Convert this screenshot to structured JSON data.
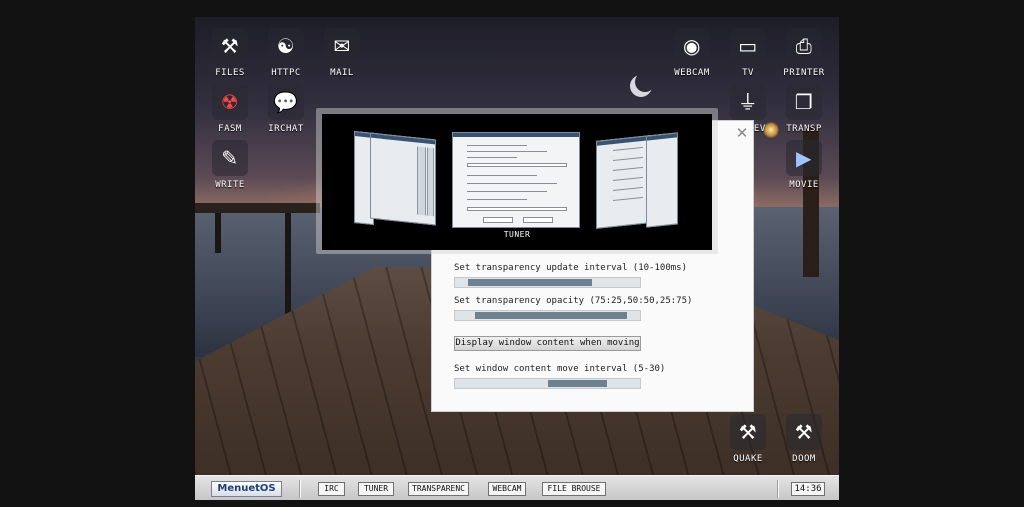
{
  "desktop": {
    "icons_left": [
      {
        "label": "FILES",
        "icon": "tools-icon",
        "glyph": "⚒"
      },
      {
        "label": "HTTPC",
        "icon": "yin-yang-icon",
        "glyph": "☯"
      },
      {
        "label": "MAIL",
        "icon": "mail-icon",
        "glyph": "✉"
      },
      {
        "label": "FASM",
        "icon": "radiation-icon",
        "glyph": "☢"
      },
      {
        "label": "IRCHAT",
        "icon": "chat-bubble-icon",
        "glyph": "💬"
      },
      {
        "label": "WRITE",
        "icon": "write-icon",
        "glyph": "✎"
      }
    ],
    "icons_right": [
      {
        "label": "WEBCAM",
        "icon": "webcam-icon",
        "glyph": "◉"
      },
      {
        "label": "TV",
        "icon": "tv-icon",
        "glyph": "▭"
      },
      {
        "label": "PRINTER",
        "icon": "printer-icon",
        "glyph": "⎙"
      },
      {
        "label": "USBDEV",
        "icon": "usb-icon",
        "glyph": "⏚"
      },
      {
        "label": "TRANSP",
        "icon": "transparency-icon",
        "glyph": "❐"
      },
      {
        "label": "MOVIE",
        "icon": "movie-icon",
        "glyph": "▶"
      },
      {
        "label": "QUAKE",
        "icon": "quake-tools-icon",
        "glyph": "⚒"
      },
      {
        "label": "DOOM",
        "icon": "doom-tools-icon",
        "glyph": "⚒"
      }
    ]
  },
  "switcher": {
    "caption": "TUNER"
  },
  "settings": {
    "close_glyph": "✕",
    "update_interval_label": "Set transparency update interval (10-100ms)",
    "opacity_label": "Set transparency opacity (75:25,50:50,25:75)",
    "display_content_button": "Display window content when moving",
    "move_interval_label": "Set window content move interval (5-30)",
    "update_interval_range": [
      0.07,
      0.74
    ],
    "opacity_range": [
      0.11,
      0.93
    ],
    "move_interval_range": [
      0.5,
      0.82
    ]
  },
  "taskbar": {
    "start_label": "MenuetOS",
    "tasks": [
      "IRC",
      "TUNER",
      "TRANSPARENC",
      "WEBCAM",
      "FILE BROUSE"
    ],
    "clock": "14:36"
  },
  "colors": {
    "slider_thumb": "#6e8190",
    "start_text": "#1f3f7a"
  }
}
